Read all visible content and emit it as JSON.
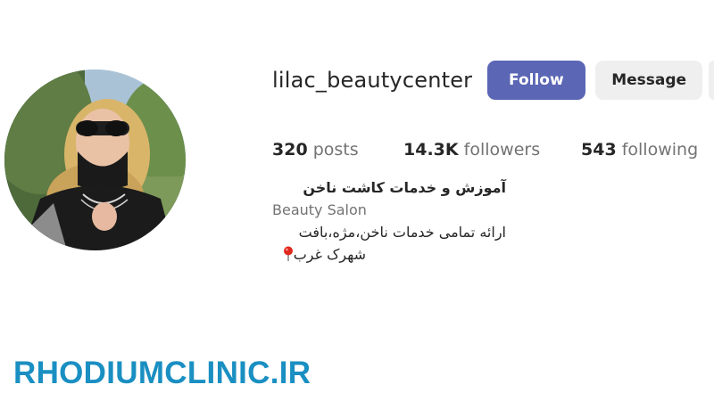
{
  "profile": {
    "username": "lilac_beautycenter",
    "avatar_icon": "profile-photo-woman-sunglasses"
  },
  "actions": {
    "follow_label": "Follow",
    "message_label": "Message"
  },
  "stats": {
    "posts_count": "320",
    "posts_label": "posts",
    "followers_count": "14.3K",
    "followers_label": "followers",
    "following_count": "543",
    "following_label": "following"
  },
  "bio": {
    "name": "آموزش و خدمات کاشت ناخن",
    "category": "Beauty Salon",
    "line1": "ارائه تمامی خدمات ناخن،مژه،بافت",
    "line2": "شهرک غرب",
    "pin_icon": "round-pushpin-icon"
  },
  "watermark": {
    "text": "RHODIUMCLINIC.IR"
  },
  "colors": {
    "follow_button": "#5b66b5",
    "message_button": "#efefef",
    "watermark": "#1a8fc2",
    "secondary_text": "#737373"
  }
}
